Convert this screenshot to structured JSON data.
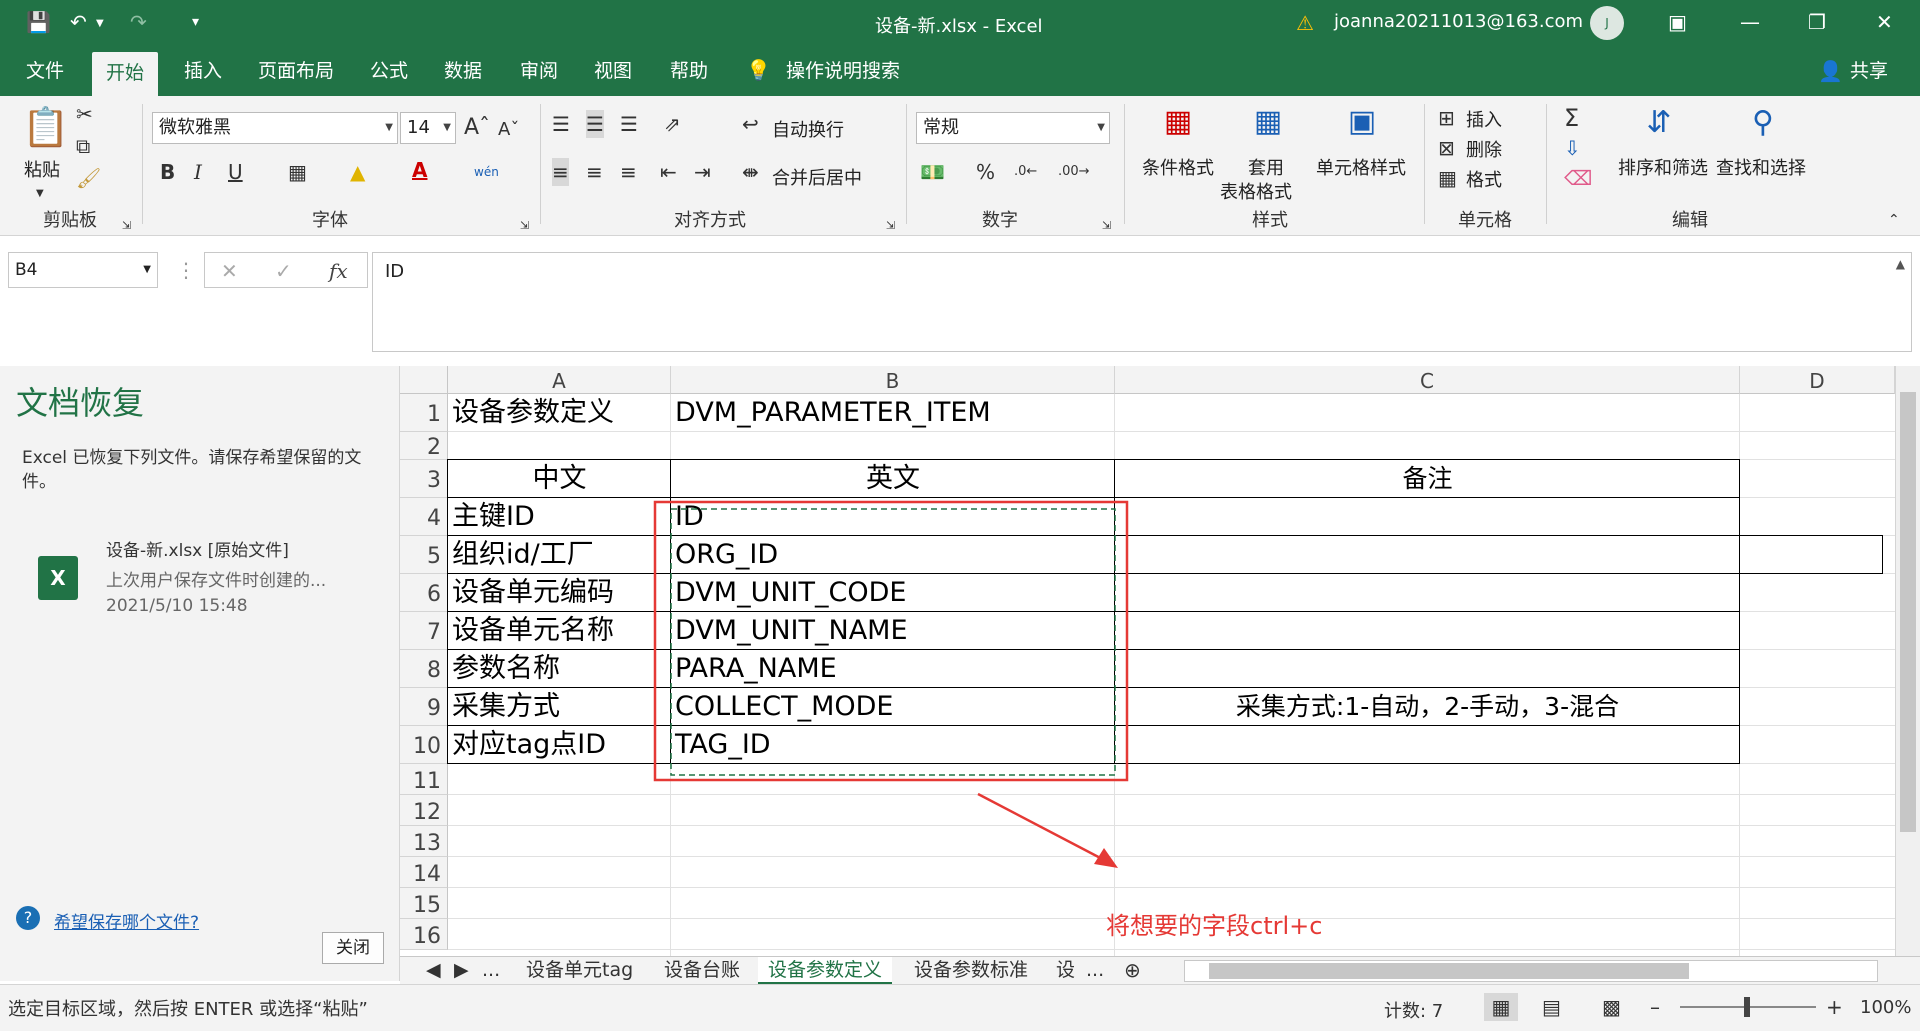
{
  "titlebar": {
    "doc_title": "设备-新.xlsx  -  Excel",
    "user": "joanna20211013@163.com",
    "avatar_initial": "J"
  },
  "tabs": [
    "文件",
    "开始",
    "插入",
    "页面布局",
    "公式",
    "数据",
    "审阅",
    "视图",
    "帮助",
    "操作说明搜索"
  ],
  "share_label": "共享",
  "ribbon": {
    "clipboard": {
      "paste": "粘贴",
      "label": "剪贴板"
    },
    "font": {
      "name": "微软雅黑",
      "size": "14",
      "label": "字体",
      "bold": "B",
      "italic": "I",
      "underline": "U",
      "phonetic": "wén"
    },
    "alignment": {
      "wrap": "自动换行",
      "merge": "合并后居中",
      "label": "对齐方式"
    },
    "number": {
      "format": "常规",
      "label": "数字",
      "percent": "%"
    },
    "styles": {
      "conditional": "条件格式",
      "table_fmt_1": "套用",
      "table_fmt_2": "表格格式",
      "cell_styles": "单元格样式",
      "label": "样式"
    },
    "cells": {
      "insert": "插入",
      "delete": "删除",
      "format": "格式",
      "label": "单元格"
    },
    "editing": {
      "sort": "排序和筛选",
      "find": "查找和选择",
      "label": "编辑"
    }
  },
  "formula_bar": {
    "name_box": "B4",
    "formula": "ID",
    "fx": "fx"
  },
  "recovery": {
    "title": "文档恢复",
    "description": "Excel 已恢复下列文件。请保存希望保留的文件。",
    "file_name": "设备-新.xlsx  [原始文件]",
    "file_desc": "上次用户保存文件时创建的...",
    "file_time": "2021/5/10 15:48",
    "help_link": "希望保存哪个文件?",
    "close": "关闭"
  },
  "grid": {
    "columns": [
      "A",
      "B",
      "C",
      "D"
    ],
    "rows": [
      {
        "num": "1",
        "a": "设备参数定义",
        "b": "DVM_PARAMETER_ITEM",
        "c": ""
      },
      {
        "num": "2",
        "a": "",
        "b": "",
        "c": ""
      },
      {
        "num": "3",
        "a": "中文",
        "b": "英文",
        "c": "备注"
      },
      {
        "num": "4",
        "a": "主键ID",
        "b": "ID",
        "c": ""
      },
      {
        "num": "5",
        "a": "组织id/工厂",
        "b": "ORG_ID",
        "c": ""
      },
      {
        "num": "6",
        "a": "设备单元编码",
        "b": "DVM_UNIT_CODE",
        "c": ""
      },
      {
        "num": "7",
        "a": "设备单元名称",
        "b": "DVM_UNIT_NAME",
        "c": ""
      },
      {
        "num": "8",
        "a": "参数名称",
        "b": "PARA_NAME",
        "c": ""
      },
      {
        "num": "9",
        "a": "采集方式",
        "b": "COLLECT_MODE",
        "c": "采集方式:1-自动，2-手动，3-混合"
      },
      {
        "num": "10",
        "a": "对应tag点ID",
        "b": "TAG_ID",
        "c": ""
      },
      {
        "num": "11",
        "a": "",
        "b": "",
        "c": ""
      },
      {
        "num": "12",
        "a": "",
        "b": "",
        "c": ""
      },
      {
        "num": "13",
        "a": "",
        "b": "",
        "c": ""
      },
      {
        "num": "14",
        "a": "",
        "b": "",
        "c": ""
      },
      {
        "num": "15",
        "a": "",
        "b": "",
        "c": ""
      },
      {
        "num": "16",
        "a": "",
        "b": "",
        "c": ""
      }
    ],
    "annotation": "将想要的字段ctrl+c"
  },
  "sheets": [
    "设备单元tag",
    "设备台账",
    "设备参数定义",
    "设备参数标准",
    "设"
  ],
  "sheet_more": "...",
  "status": {
    "message": "选定目标区域，然后按 ENTER 或选择“粘贴”",
    "count": "计数: 7",
    "zoom": "100%"
  },
  "colors": {
    "accent": "#217346",
    "annotation": "#e53935"
  }
}
